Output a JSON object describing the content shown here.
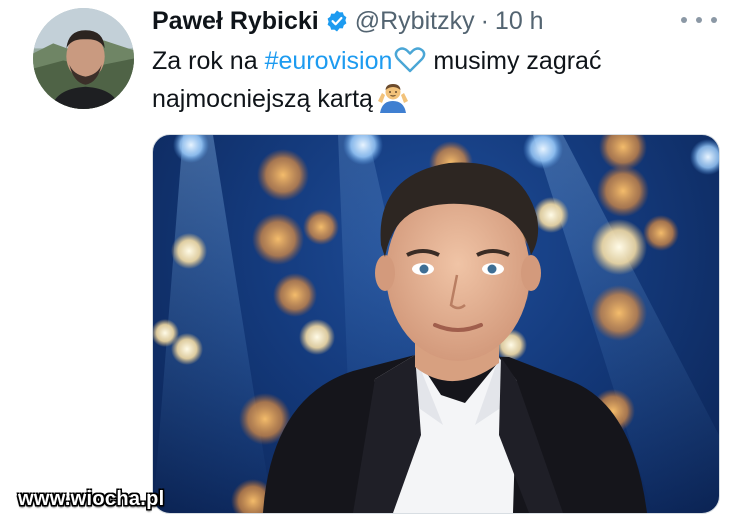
{
  "tweet": {
    "author_name": "Paweł Rybicki",
    "author_handle": "@Rybitzky",
    "separator": "·",
    "time": "10 h",
    "text_before_hashtag": "Za rok na ",
    "hashtag": "#eurovision",
    "text_after_heart": " musimy zagrać",
    "text_line2": "najmocniejszą kartą",
    "heart_emoji": "blue-heart-icon",
    "shrug_emoji": "man-shrugging-icon",
    "verified_icon": "verified-badge-icon",
    "more_icon": "more-options-icon"
  },
  "colors": {
    "link": "#1d9bf0",
    "secondary_text": "#536471",
    "verified": "#1d9bf0"
  },
  "watermark": {
    "text": "www.wiocha.pl"
  }
}
